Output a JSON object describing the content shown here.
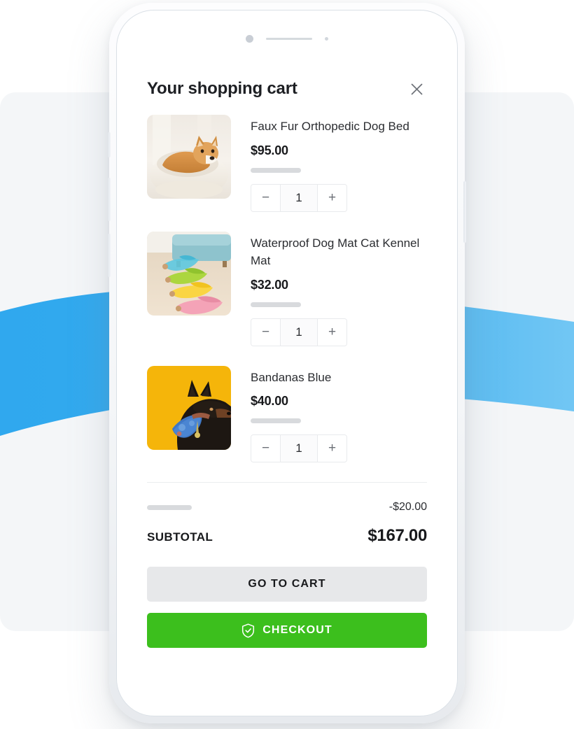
{
  "theme": {
    "accent_green": "#3cbf1d",
    "ribbon_blue_left": "#2fa8ee",
    "ribbon_blue_right": "#73c7f3",
    "page_bg": "#ffffff",
    "card_bg": "#f4f6f8"
  },
  "header": {
    "title": "Your shopping cart",
    "close_icon": "close-icon"
  },
  "items": [
    {
      "name": "Faux Fur Orthopedic Dog Bed",
      "price": "$95.00",
      "quantity": "1",
      "decrement_label": "−",
      "increment_label": "+",
      "image_alt": "shiba-inu-on-cream-faux-fur-dog-bed"
    },
    {
      "name": "Waterproof Dog Mat Cat Kennel Mat",
      "price": "$32.00",
      "quantity": "1",
      "decrement_label": "−",
      "increment_label": "+",
      "image_alt": "colorful-banana-shaped-pet-beds-on-wood-floor"
    },
    {
      "name": "Bandanas Blue",
      "price": "$40.00",
      "quantity": "1",
      "decrement_label": "−",
      "increment_label": "+",
      "image_alt": "doberman-with-blue-bandana-on-yellow-background"
    }
  ],
  "summary": {
    "discount_value": "-$20.00",
    "subtotal_label": "SUBTOTAL",
    "subtotal_value": "$167.00"
  },
  "actions": {
    "go_to_cart_label": "GO TO CART",
    "checkout_label": "CHECKOUT",
    "checkout_icon": "shield-check-icon"
  }
}
